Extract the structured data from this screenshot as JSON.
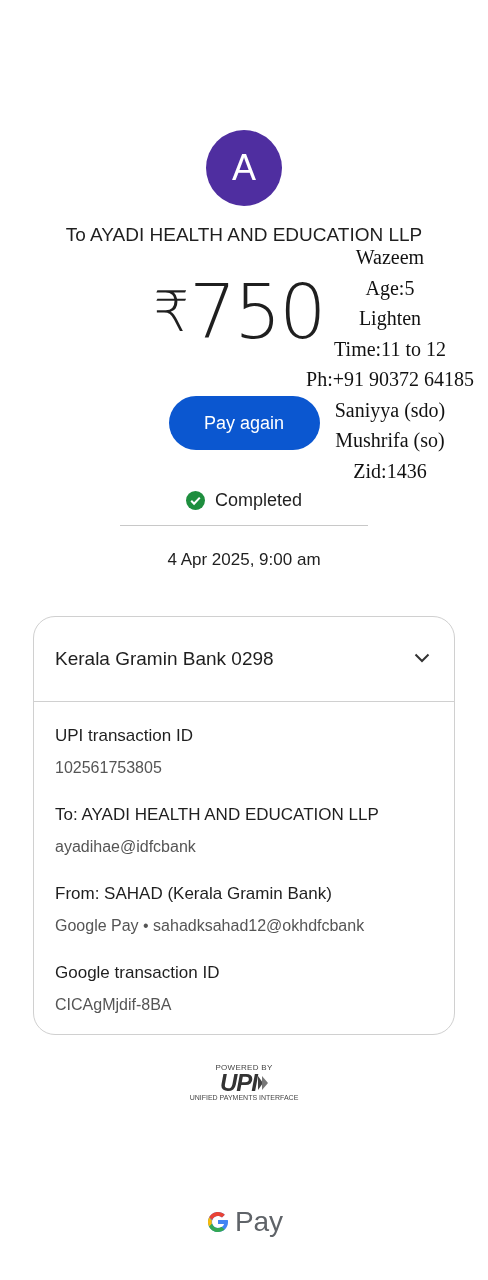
{
  "avatar": {
    "letter": "A"
  },
  "recipient_title": "To AYADI HEALTH AND EDUCATION LLP",
  "amount": {
    "currency": "₹",
    "value": "750"
  },
  "note_lines": [
    "Wazeem",
    "Age:5",
    "Lighten",
    "Time:11 to 12",
    "Ph:+91 90372 64185",
    "Saniyya (sdo)",
    "Mushrifa (so)",
    "Zid:1436"
  ],
  "primary_button": "Pay again",
  "status": {
    "kind": "completed",
    "label": "Completed"
  },
  "date": "4 Apr 2025, 9:00 am",
  "account_card": {
    "title": "Kerala Gramin Bank 0298",
    "expanded": true,
    "details": [
      {
        "label": "UPI transaction ID",
        "value": "102561753805"
      },
      {
        "label": "To: AYADI HEALTH AND EDUCATION LLP",
        "value": "ayadihae@idfcbank"
      },
      {
        "label": "From: SAHAD (Kerala Gramin Bank)",
        "value": "Google Pay • sahadksahad12@okhdfcbank"
      },
      {
        "label": "Google transaction ID",
        "value": "CICAgMjdif-8BA"
      }
    ]
  },
  "footer": {
    "powered_by": "POWERED BY",
    "upi": "UPI",
    "upi_subtitle": "UNIFIED PAYMENTS INTERFACE",
    "brand": "Pay"
  }
}
